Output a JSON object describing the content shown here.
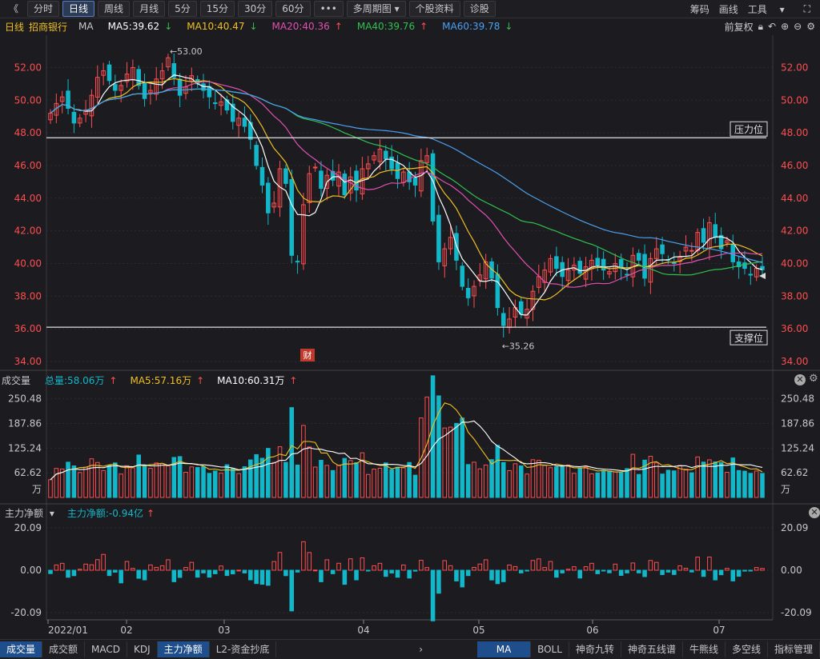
{
  "toolbar": {
    "back": "《",
    "periods": [
      "分时",
      "日线",
      "周线",
      "月线",
      "5分",
      "15分",
      "30分",
      "60分"
    ],
    "more": "•••",
    "multi": "多周期图",
    "profile": "个股资料",
    "diag": "诊股",
    "right": [
      "筹码",
      "画线",
      "工具"
    ]
  },
  "indicators": {
    "period": "日线",
    "name": "招商银行",
    "ma_label": "MA",
    "ma5": "MA5:39.62",
    "ma10": "MA10:40.47",
    "ma20": "MA20:40.36",
    "ma40": "MA40:39.76",
    "ma60": "MA60:39.78",
    "adjust": "前复权"
  },
  "colors": {
    "up": "#ff4d4f",
    "down": "#12b7c9",
    "ma5": "#ffffff",
    "ma10": "#f0c020",
    "ma20": "#e050b0",
    "ma40": "#30c050",
    "ma60": "#4aa0f0",
    "axis": "#ff4d4f"
  },
  "price_panel": {
    "y_ticks": [
      "52.00",
      "50.00",
      "48.00",
      "46.00",
      "44.00",
      "42.00",
      "40.00",
      "38.00",
      "36.00",
      "34.00"
    ],
    "resistance_label": "压力位",
    "support_label": "支撑位",
    "high_label": "←53.00",
    "low_label": "←35.26",
    "event_badge": "财"
  },
  "volume_panel": {
    "title": "成交量",
    "total": "总量:58.06万",
    "ma5": "MA5:57.16万",
    "ma10": "MA10:60.31万",
    "y_ticks": [
      "250.48",
      "187.86",
      "125.24",
      "62.62"
    ],
    "unit": "万"
  },
  "moneyflow_panel": {
    "title": "主力净额",
    "value": "主力净额:-0.94亿",
    "y_ticks": [
      "20.09",
      "0.00",
      "-20.09"
    ]
  },
  "x_labels": [
    "2022/01",
    "02",
    "03",
    "04",
    "05",
    "06",
    "07"
  ],
  "bottom_tabs": [
    "成交量",
    "成交额",
    "MACD",
    "KDJ",
    "主力净额",
    "L2-资金抄底"
  ],
  "bottom_right_tabs": [
    "MA",
    "BOLL",
    "神奇九转",
    "神奇五线谱",
    "牛熊线",
    "多空线",
    "指标管理"
  ],
  "chart_data": {
    "type": "candlestick",
    "y_range": [
      34,
      53
    ],
    "high": 53.0,
    "low": 35.26,
    "resistance": 47.7,
    "support": 36.1,
    "close": [
      49.2,
      49.8,
      50.2,
      49.5,
      48.6,
      48.9,
      49.4,
      50.3,
      51.4,
      51.8,
      51.2,
      50.6,
      50.9,
      51.6,
      52.0,
      50.9,
      50.1,
      50.6,
      51.3,
      51.8,
      52.6,
      51.4,
      50.3,
      50.8,
      51.5,
      51.0,
      50.6,
      50.2,
      49.8,
      49.9,
      49.4,
      48.7,
      48.9,
      48.4,
      47.6,
      46.0,
      44.8,
      43.1,
      43.7,
      45.8,
      44.9,
      40.5,
      40.1,
      43.6,
      45.5,
      45.9,
      44.6,
      45.4,
      45.1,
      45.6,
      44.2,
      45.3,
      44.5,
      45.8,
      46.1,
      46.6,
      47.0,
      46.4,
      45.8,
      45.2,
      45.6,
      45.0,
      44.8,
      46.3,
      46.6,
      42.6,
      40.1,
      40.9,
      41.6,
      40.2,
      38.6,
      37.9,
      38.6,
      39.3,
      40.1,
      39.1,
      37.3,
      36.2,
      36.6,
      37.3,
      36.9,
      37.2,
      38.3,
      39.2,
      39.6,
      40.3,
      39.7,
      39.2,
      39.6,
      39.9,
      39.4,
      39.8,
      40.2,
      39.9,
      39.6,
      39.5,
      40.0,
      39.7,
      39.3,
      40.5,
      40.2,
      39.1,
      40.3,
      40.9,
      40.6,
      40.2,
      40.0,
      40.4,
      41.0,
      40.8,
      41.9,
      41.3,
      42.5,
      41.6,
      40.9,
      41.4,
      40.1,
      39.8,
      39.7,
      39.3,
      39.7,
      39.62
    ],
    "ma5_last": 39.62,
    "ma10_last": 40.47,
    "ma20_last": 40.36,
    "ma40_last": 39.76,
    "ma60_last": 39.78,
    "volume_range": [
      0,
      260
    ],
    "volume_last": 58.06,
    "moneyflow_range": [
      -20.09,
      20.09
    ],
    "moneyflow_last": -0.94
  }
}
